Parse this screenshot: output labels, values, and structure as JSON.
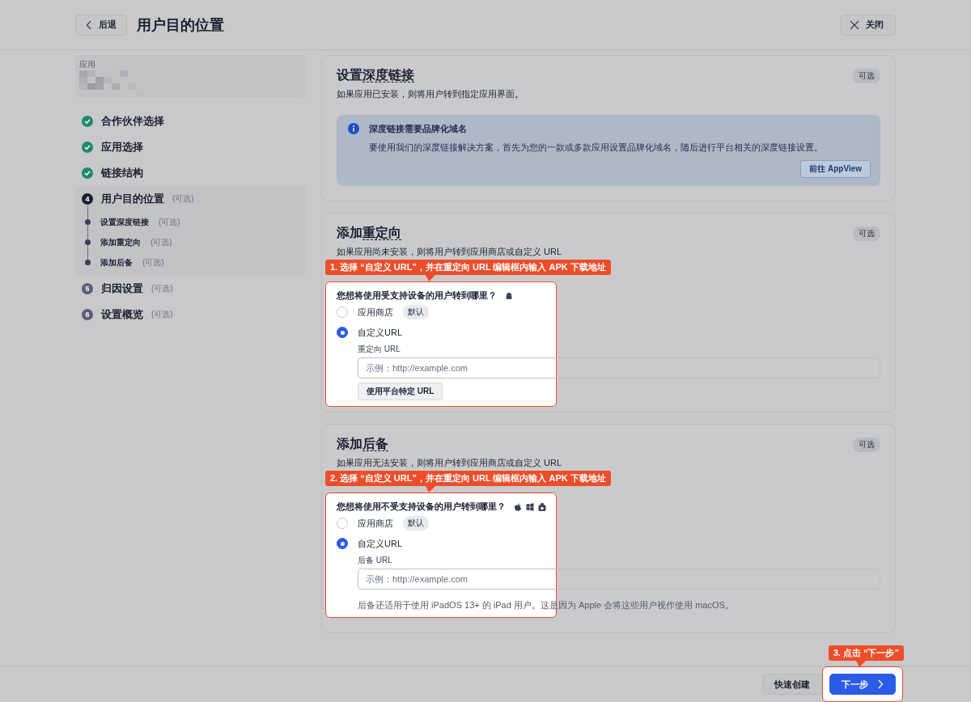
{
  "header": {
    "back_button": "后退",
    "title": "用户目的位置",
    "close_button": "关闭"
  },
  "sidebar": {
    "app_label": "应用",
    "steps": [
      {
        "label": "合作伙伴选择",
        "kind": "done"
      },
      {
        "label": "应用选择",
        "kind": "done"
      },
      {
        "label": "链接结构",
        "kind": "done"
      },
      {
        "label": "用户目的位置",
        "kind": "current",
        "number": "4",
        "tag": "(可选)",
        "children": [
          {
            "label": "设置深度链接",
            "tag": "(可选)"
          },
          {
            "label": "添加重定向",
            "tag": "(可选)"
          },
          {
            "label": "添加后备",
            "tag": "(可选)"
          }
        ]
      },
      {
        "label": "归因设置",
        "kind": "upcoming",
        "number": "5",
        "tag": "(可选)"
      },
      {
        "label": "设置概览",
        "kind": "upcoming",
        "number": "6",
        "tag": "(可选)"
      }
    ]
  },
  "sections": [
    {
      "title": "设置",
      "title_term": "深度链接",
      "badge": "可选",
      "subtitle": "如果应用已安装，则将用户转到指定应用界面。",
      "info": {
        "title": "深度链接需要品牌化域名",
        "text": "要使用我们的深度链接解决方案，首先为您的一款或多款应用设置品牌化域名，随后进行平台相关的深度链接设置。",
        "button": "前往 AppView"
      }
    },
    {
      "title": "添加",
      "title_term": "重定向",
      "badge": "可选",
      "subtitle": "如果应用尚未安装，则将用户转到应用商店或自定义 URL",
      "callout": "1. 选择 “自定义 URL”，并在重定向 URL 编辑框内输入 APK 下载地址",
      "form": {
        "question": "您想将使用受支持设备的用户转到哪里？",
        "options": [
          {
            "label": "应用商店",
            "tag": "默认",
            "selected": false
          },
          {
            "label": "自定义URL",
            "selected": true
          }
        ],
        "field_label": "重定向 URL",
        "placeholder": "示例：http://example.com",
        "button": "使用平台特定 URL"
      }
    },
    {
      "title": "添加",
      "title_term": "后备",
      "badge": "可选",
      "subtitle": "如果应用无法安装，则将用户转到应用商店或自定义 URL",
      "callout": "2. 选择 “自定义 URL”，并在重定向 URL 编辑框内输入 APK 下载地址",
      "form": {
        "question": "您想将使用不受支持设备的用户转到哪里？",
        "options": [
          {
            "label": "应用商店",
            "tag": "默认",
            "selected": false
          },
          {
            "label": "自定义URL",
            "selected": true
          }
        ],
        "field_label": "后备 URL",
        "placeholder": "示例：http://example.com",
        "note": "后备还适用于使用 iPadOS 13+ 的 iPad 用户。这是因为 Apple 会将这些用户视作使用 macOS。"
      }
    }
  ],
  "footer": {
    "buttons": [
      {
        "label": "快速创建",
        "kind": "secondary"
      },
      {
        "label": "下一步",
        "kind": "primary",
        "callout": "3. 点击 “下一步”"
      }
    ]
  }
}
